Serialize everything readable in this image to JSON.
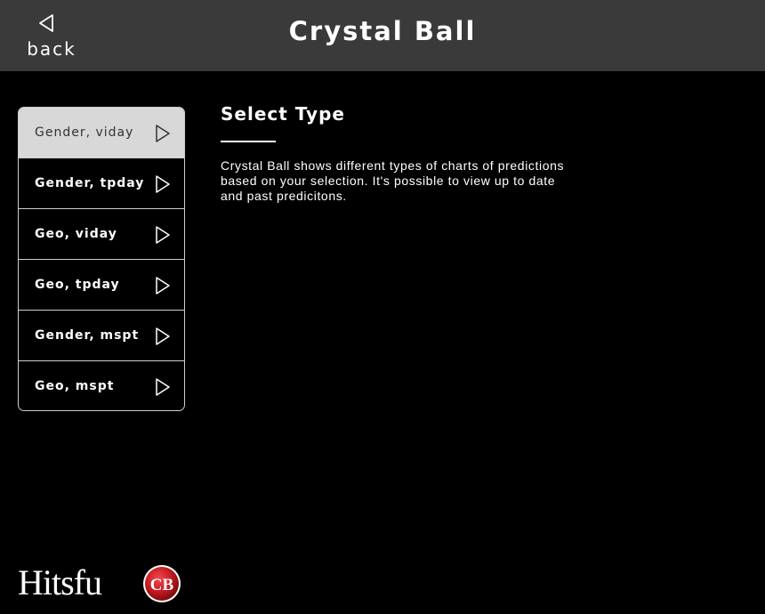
{
  "header": {
    "title": "Crystal Ball",
    "back_label": "back"
  },
  "type_list": {
    "selected_index": 0,
    "items": [
      {
        "label": "Gender, viday"
      },
      {
        "label": "Gender, tpday"
      },
      {
        "label": "Geo, viday"
      },
      {
        "label": "Geo, tpday"
      },
      {
        "label": "Gender, mspt"
      },
      {
        "label": "Geo, mspt"
      }
    ]
  },
  "main": {
    "title": "Select Type",
    "description": "Crystal Ball shows different types of charts of predictions based on your selection. It's possible to view up to date and past predicitons."
  },
  "footer": {
    "brand": "Hitsfu",
    "badge_text": "CB"
  },
  "icons": {
    "back": "triangle-left-outline-icon",
    "item_arrow": "triangle-right-outline-icon"
  },
  "colors": {
    "background": "#000000",
    "header_bg": "#3a3a3a",
    "selected_item_bg": "#d8d8d8",
    "badge_red": "#c41a1f"
  }
}
